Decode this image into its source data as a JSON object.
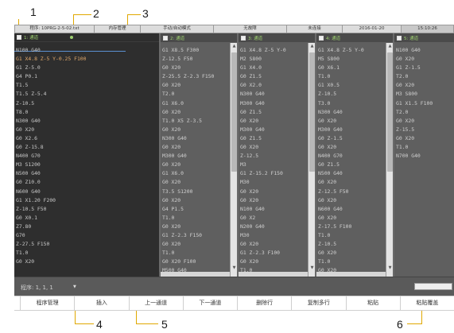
{
  "callouts": [
    "1",
    "2",
    "3",
    "4",
    "5",
    "6"
  ],
  "status_bar": {
    "cells": [
      "程序: 10PRG-2-5-02.txt",
      "内存管理",
      "手动/自动模式",
      "无故障",
      "未连接",
      "2016-01-20",
      "15:10:26"
    ]
  },
  "panes": [
    {
      "title": "1: 通道",
      "lines": [
        "N100 G40",
        "G1 X4.8 Z-5 Y-0.25 F100",
        "G1 Z-5.0",
        "G4 P0.1",
        "T1.5",
        "T1.5 Z-5.4",
        "Z-10.5",
        "T8.0",
        "N300 G40",
        "G0 X20",
        "G0 X2.6",
        "G0 Z-15.8",
        "N400 G70",
        "M3 S1200",
        "N500 G40",
        "G0 Z10.0",
        "N600 G40",
        "G1 X1.20 F200",
        "Z-10.5 F50",
        "G0 X0.1",
        "Z7.80",
        "G70",
        "Z-27.5 F150",
        "T1.0",
        "G0 X20"
      ],
      "highlight_lines": [
        1
      ]
    },
    {
      "title": "2: 通道",
      "lines": [
        "G1 X8.5 F300",
        "Z-12.5 F50",
        "G0 X20",
        "Z-25.5 Z-2.3 F150",
        "G0 X20",
        "T2.0",
        "G1 X6.0",
        "G0 X20",
        "T1.0 X5 Z-3.5",
        "G0 X20",
        "N300 G40",
        "G0 X20",
        "M300 G40",
        "G0 X20",
        "G1 X6.0",
        "G0 X20",
        "T3.5 S1200",
        "G0 X20",
        "G4 P1.5",
        "T1.0",
        "G0 X20",
        "G1 Z-2.3 F150",
        "G0 X20",
        "T1.0",
        "G0 X20 F100",
        "M500 G40",
        "M30"
      ]
    },
    {
      "title": "3: 通道",
      "lines": [
        "G1 X4.8 Z-5 Y-0",
        "M2 S800",
        "G1 X4.0",
        "G0 Z1.5",
        "G0 X2.0",
        "N300 G40",
        "M300 G40",
        "G0 Z1.5",
        "G0 X20",
        "M300 G40",
        "G0 Z1.5",
        "G0 X20",
        "Z-12.5",
        "M3",
        "G1 Z-15.2 F150",
        "M30",
        "G0 X20",
        "G0 X20",
        "N100 G40",
        "G0 X2",
        "N200 G40",
        "M30",
        "G0 X20",
        "G1 Z-2.3 F100",
        "G0 X20",
        "T1.0",
        "M30"
      ]
    },
    {
      "title": "4: 通道",
      "lines": [
        "G1 X4.8 Z-5 Y-0",
        "M5 S800",
        "G0 X6.1",
        "T1.0",
        "G1 X0.5",
        "Z-10.5",
        "T3.0",
        "N300 G40",
        "G0 X20",
        "M300 G40",
        "G0 Z-1.5",
        "G0 X20",
        "N400 G70",
        "G0 Z1.5",
        "N500 G40",
        "G0 X20",
        "Z-12.5 F50",
        "G0 X20",
        "N600 G40",
        "G0 X20",
        "Z-17.5 F100",
        "T1.0",
        "Z-10.5",
        "G0 X20",
        "T1.0",
        "G0 X20",
        "M30"
      ]
    },
    {
      "title": "5: 通道",
      "lines": [
        "N100 G40",
        "G0 X20",
        "G1 Z-1.5",
        "T2.0",
        "G0 X20",
        "M3 S800",
        "G1 X1.5 F100",
        "T2.0",
        "G0 X20",
        "Z-15.5",
        "G0 X20",
        "T1.0",
        "N700 G40"
      ]
    }
  ],
  "program_row": {
    "label": "程序: 1, 1, 1"
  },
  "softkeys": [
    "程序管理",
    "插入",
    "上一通道",
    "下一通道",
    "删除行",
    "复制多行",
    "粘贴",
    "粘贴覆盖"
  ]
}
